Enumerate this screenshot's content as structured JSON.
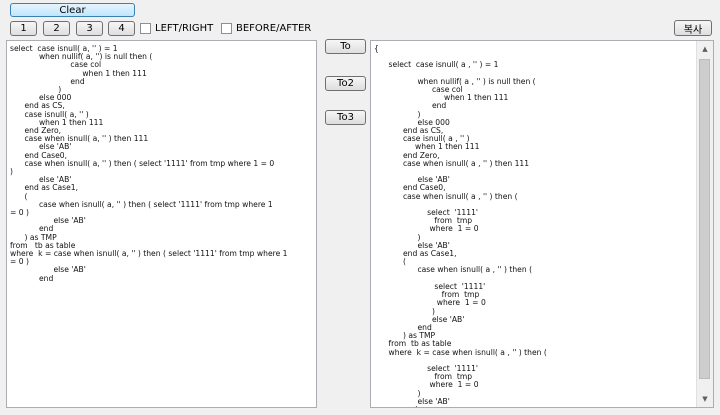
{
  "toolbar": {
    "clear_label": "Clear",
    "num_buttons": [
      "1",
      "2",
      "3",
      "4"
    ],
    "checkbox_left_right": "LEFT/RIGHT",
    "checkbox_before_after": "BEFORE/AFTER",
    "copy_label": "복사"
  },
  "middle": {
    "to_label": "To",
    "to2_label": "To2",
    "to3_label": "To3"
  },
  "left_editor": {
    "text": "select  case isnull( a, '' ) = 1\n            when nullif( a, '') is null then (\n                         case col\n                              when 1 then 111\n                         end\n                    )\n            else 000\n      end as CS,\n      case isnull( a, '' )\n            when 1 then 111\n      end Zero,\n      case when isnull( a, '' ) then 111\n            else 'AB'\n      end Case0,\n      case when isnull( a, '' ) then ( select '1111' from tmp where 1 = 0\n)\n            else 'AB'\n      end as Case1,\n      (\n            case when isnull( a, '' ) then ( select '1111' from tmp where 1\n= 0 )\n                  else 'AB'\n            end\n      ) as TMP\nfrom   tb as table\nwhere  k = case when isnull( a, '' ) then ( select '1111' from tmp where 1\n= 0 )\n                  else 'AB'\n            end"
  },
  "right_editor": {
    "text": "{\n\n      select  case isnull( a , '' ) = 1\n\n                  when nullif( a , '' ) is null then (\n                        case col\n                             when 1 then 111\n                        end\n                  )\n                  else 000\n            end as CS,\n            case isnull( a , '' )\n                 when 1 then 111\n            end Zero,\n            case when isnull( a , '' ) then 111\n\n                  else 'AB'\n            end Case0,\n            case when isnull( a , '' ) then (\n\n                      select  '1111'\n                         from  tmp\n                       where  1 = 0\n                  )\n                  else 'AB'\n            end as Case1,\n            (\n                  case when isnull( a , '' ) then (\n\n                         select  '1111'\n                            from  tmp\n                          where  1 = 0\n                        )\n                        else 'AB'\n                  end\n            ) as TMP\n      from  tb as table\n      where  k = case when isnull( a , '' ) then (\n\n                      select  '1111'\n                         from  tmp\n                       where  1 = 0\n                  )\n                  else 'AB'\n            end\n}"
  },
  "scrollbar": {
    "up_arrow": "▲",
    "down_arrow": "▼"
  }
}
